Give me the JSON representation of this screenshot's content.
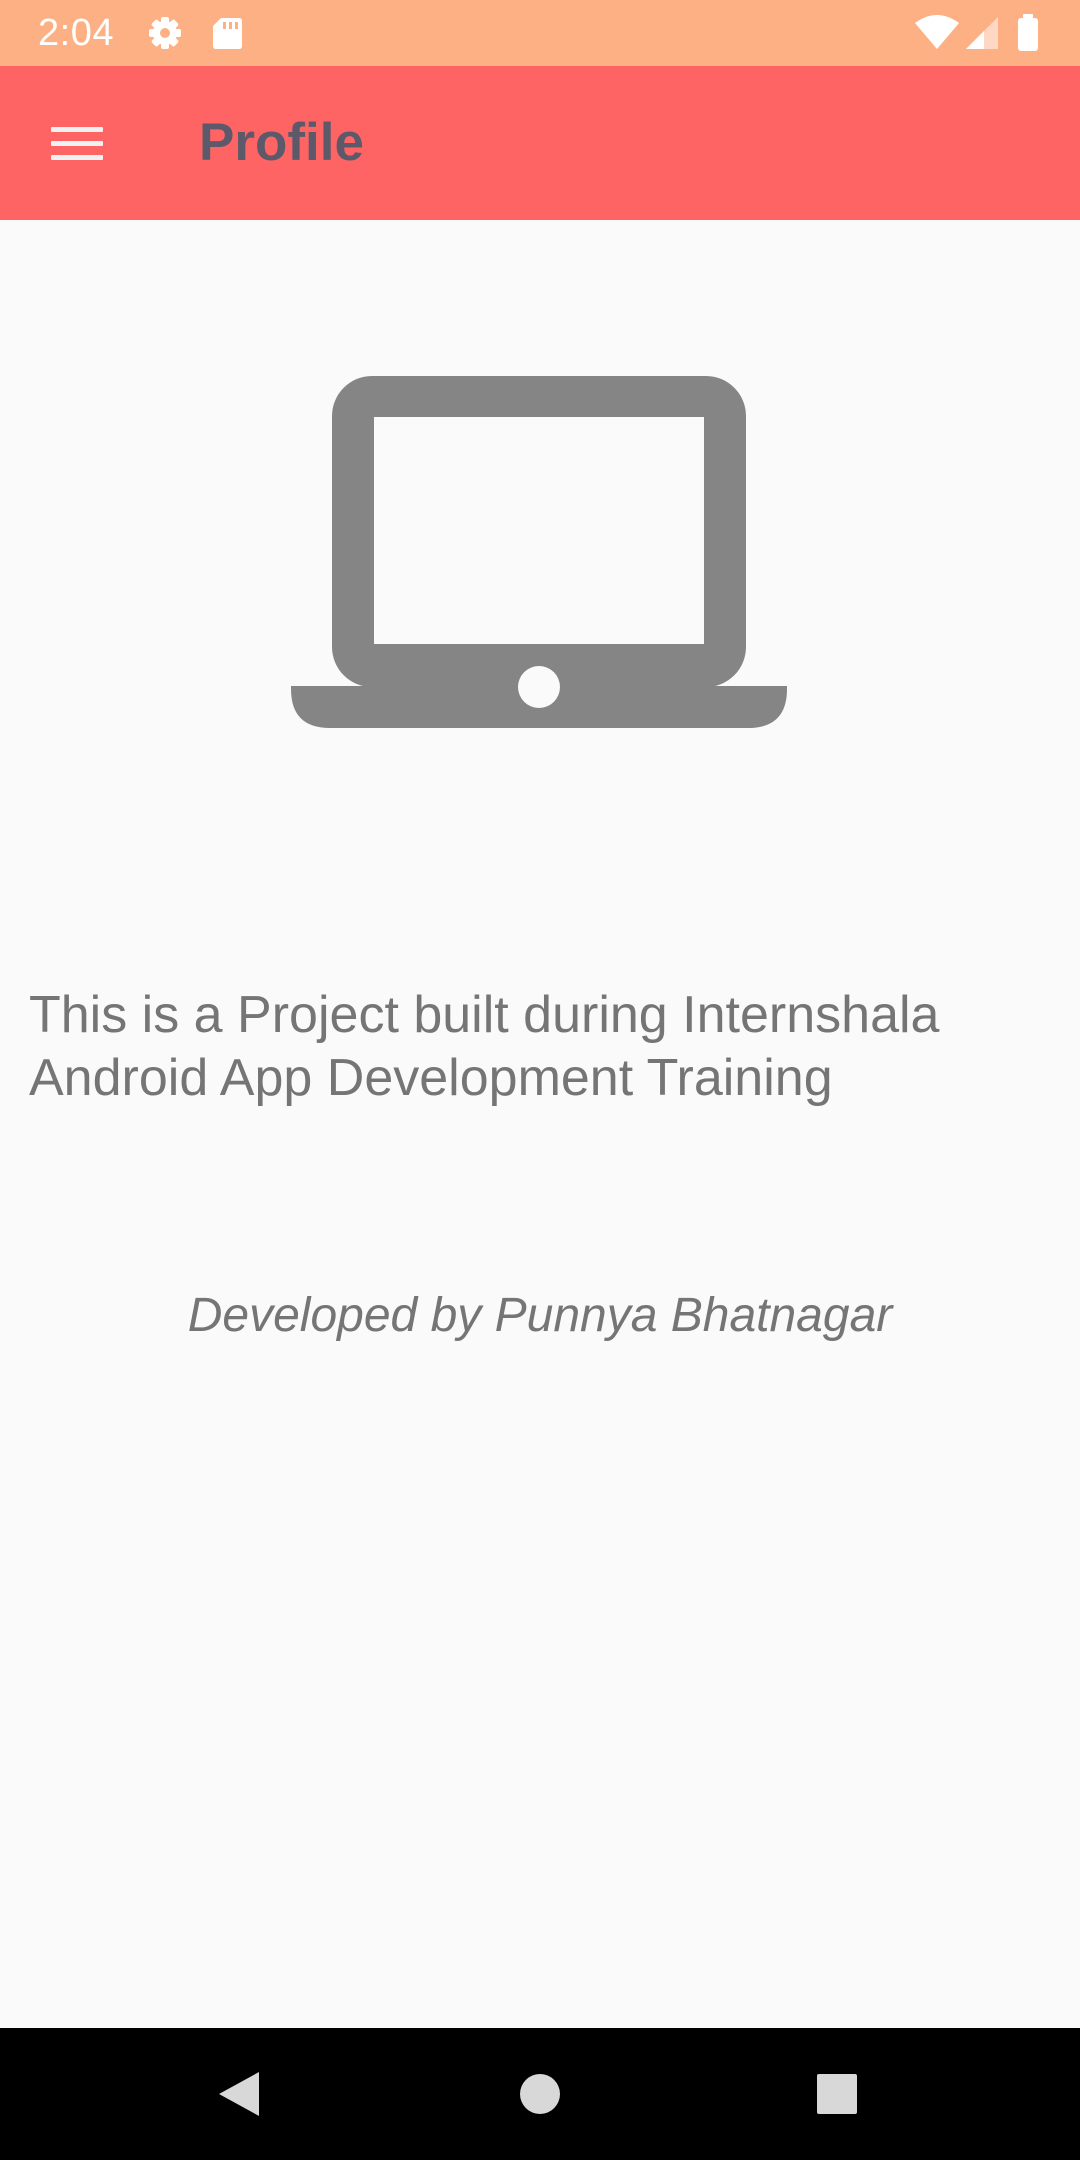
{
  "status_bar": {
    "time": "2:04",
    "icons": [
      "settings-icon",
      "sd-card-icon",
      "wifi-icon",
      "cell-signal-icon",
      "battery-icon"
    ],
    "background": "#fdb084"
  },
  "app_bar": {
    "title": "Profile",
    "menu_icon": "hamburger-menu-icon",
    "background": "#ff6464",
    "title_color": "#5c5a6a"
  },
  "main": {
    "illustration": "laptop-icon",
    "description": "This is a Project built during Internshala Android App Development Training",
    "credit": "Developed by Punnya Bhatnagar",
    "text_color": "#757575",
    "illustration_color": "#858585"
  },
  "nav_bar": {
    "buttons": [
      "back-icon",
      "home-icon",
      "recents-icon"
    ]
  }
}
